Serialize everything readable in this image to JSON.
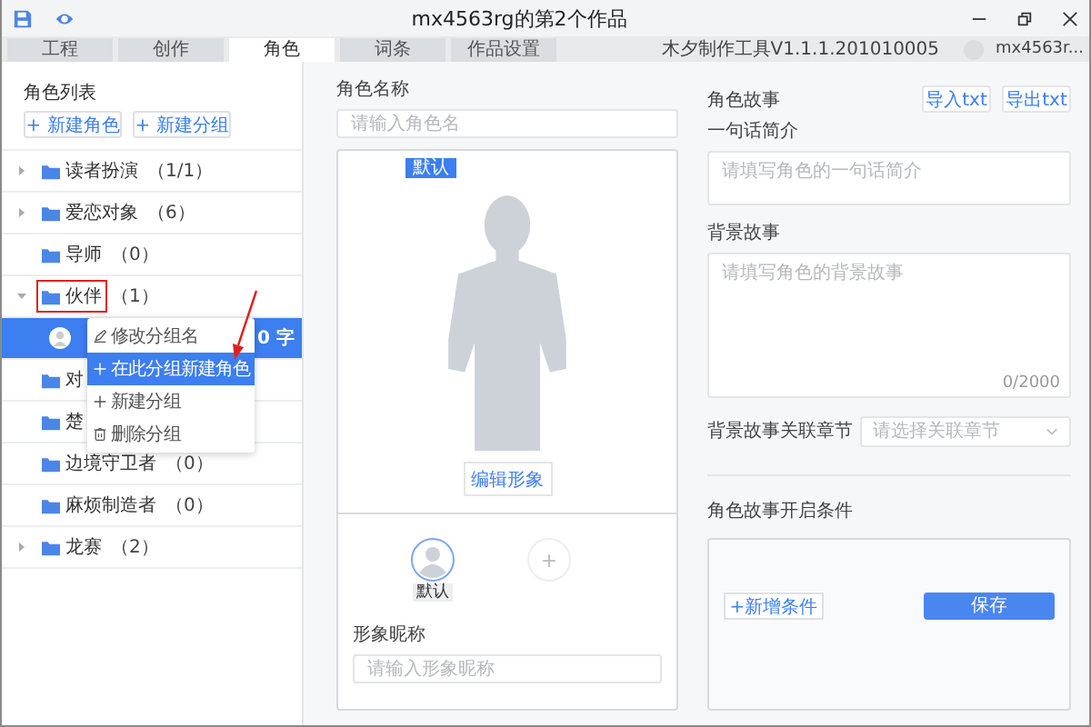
{
  "window": {
    "title": "mx4563rg的第2个作品"
  },
  "tabs": [
    {
      "label": "工程",
      "selected": false
    },
    {
      "label": "创作",
      "selected": false
    },
    {
      "label": "角色",
      "selected": true
    },
    {
      "label": "词条",
      "selected": false
    },
    {
      "label": "作品设置",
      "selected": false
    }
  ],
  "app_version": "木夕制作工具V1.1.1.201010005",
  "user": "mx4563r...",
  "sidebar": {
    "title": "角色列表",
    "buttons": [
      "+ 新建角色",
      "+ 新建分组"
    ],
    "groups": [
      {
        "name": "读者扮演",
        "count": "（1/1）",
        "expandable": true,
        "expanded": false,
        "highlighted": false
      },
      {
        "name": "爱恋对象",
        "count": "（6）",
        "expandable": true,
        "expanded": false,
        "highlighted": false
      },
      {
        "name": "导师",
        "count": "（0）",
        "expandable": false,
        "highlighted": false
      },
      {
        "name": "伙伴",
        "count": "（1）",
        "expandable": true,
        "expanded": true,
        "highlighted": true,
        "children": [
          {
            "text": "0 字",
            "selected": true
          }
        ]
      },
      {
        "name": "对",
        "expandable": false,
        "highlighted": false
      },
      {
        "name": "楚",
        "expandable": false,
        "highlighted": false
      },
      {
        "name": "边境守卫者",
        "count": "（0）",
        "expandable": false,
        "highlighted": false
      },
      {
        "name": "麻烦制造者",
        "count": "（0）",
        "expandable": false,
        "highlighted": false
      },
      {
        "name": "龙赛",
        "count": "（2）",
        "expandable": true,
        "expanded": false,
        "highlighted": false
      }
    ]
  },
  "context_menu": {
    "items": [
      {
        "label": "修改分组名",
        "selected": false
      },
      {
        "label": "在此分组新建角色",
        "selected": true
      },
      {
        "label": "新建分组",
        "selected": false
      },
      {
        "label": "删除分组",
        "selected": false
      }
    ]
  },
  "character": {
    "name_field": {
      "label": "角色名称",
      "placeholder": "请输入角色名"
    },
    "default_badge": "默认",
    "edit_button": "编辑形象",
    "avatars": [
      {
        "label": "默认",
        "selected": true
      }
    ],
    "add_avatar": "+",
    "nickname_field": {
      "label": "形象昵称",
      "placeholder": "请输入形象昵称"
    }
  },
  "story": {
    "title": "角色故事",
    "buttons": [
      "导入txt",
      "导出txt"
    ],
    "summary": {
      "label": "一句话简介",
      "placeholder": "请填写角色的一句话简介"
    },
    "background": {
      "label": "背景故事",
      "placeholder": "请填写角色的背景故事",
      "counter": "0/2000"
    },
    "chapter": {
      "label": "背景故事关联章节",
      "placeholder": "请选择关联章节"
    },
    "conditions": {
      "title": "角色故事开启条件",
      "add_button": "+新增条件",
      "save_button": "保存"
    }
  }
}
